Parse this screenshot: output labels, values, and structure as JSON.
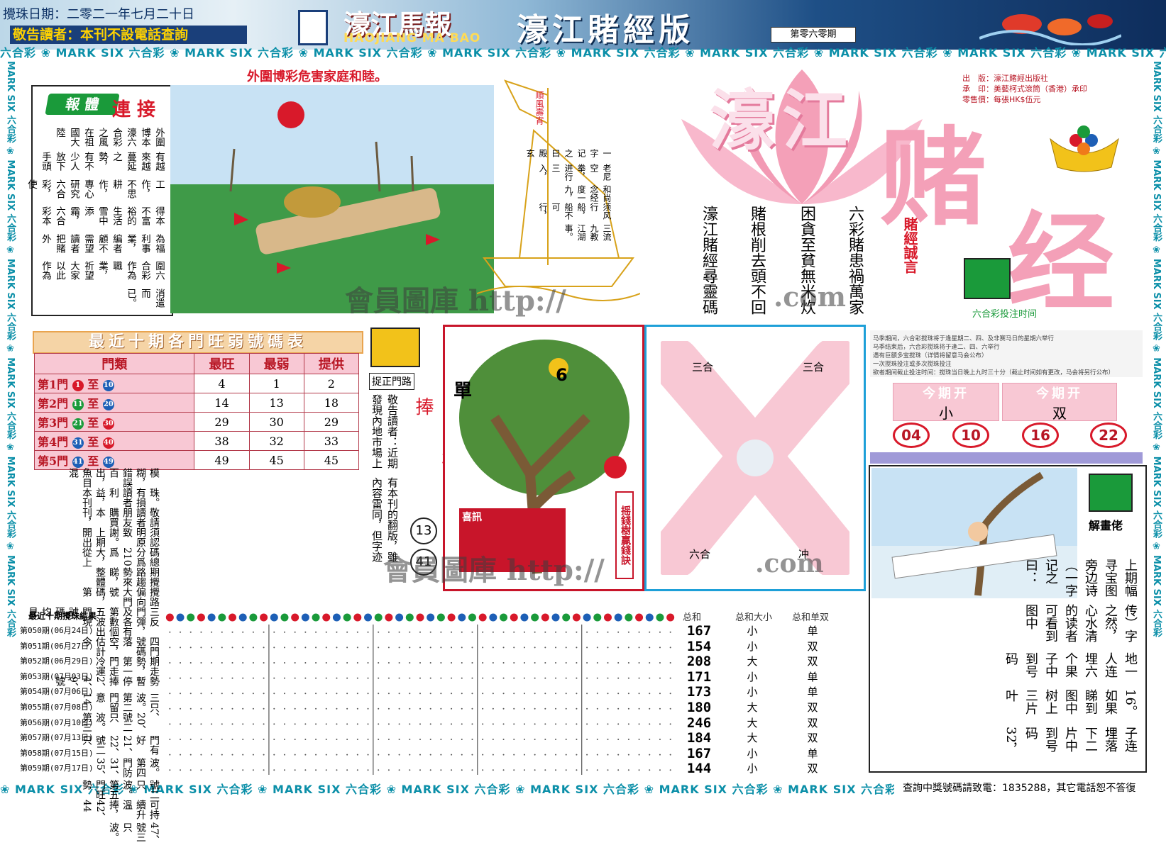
{
  "header": {
    "date_line": "攪珠日期：二零二一年七月二十日",
    "notice": "敬告讀者：本刊不設電話查詢",
    "paper_name": "濠江馬報",
    "paper_en": "HAOJIANG MA BAO",
    "edition": "濠江賭經版",
    "issue": "第零六零期"
  },
  "border": {
    "top": "六合彩 ❀ MARK SIX 六合彩 ❀ MARK SIX 六合彩 ❀ MARK SIX 六合彩 ❀ MARK SIX 六合彩 ❀ MARK SIX 六合彩 ❀ MARK SIX 六合彩 ❀ MARK SIX 六合彩 ❀ MARK SIX 六合彩 ❀ MARK SIX 六合彩 ❀ MARK SIX 六合彩 ❀ MARK SIX",
    "bottom": "❀ MARK SIX 六合彩 ❀ MARK SIX 六合彩 ❀ MARK SIX 六合彩 ❀ MARK SIX 六合彩 ❀ MARK SIX 六合彩 ❀ MARK SIX 六合彩 ❀ MARK SIX 六合彩 ❀ MA",
    "side": "MARK SIX 六合彩 ❀ MARK SIX 六合彩 ❀ MARK SIX 六合彩 ❀ MARK SIX 六合彩 ❀ MARK SIX 六合彩 ❀ MARK SIX 六合彩"
  },
  "article": {
    "headline": "外圍博彩危害家庭和睦。",
    "tag": "報 體",
    "tag2": "連 接",
    "col1": "外圍博本濠六合彩之風在祖國大陸",
    "col2": "有越來越蔓延之勢，有不少人放下手頭",
    "col3": "工作，不思耕作，專心研究六合彩，使",
    "col4": "得本不富裕的生活雪中添霜，六合彩本",
    "col5": "為福利事業，編者顧不需望讀者把賭外",
    "col6": "圍六合彩作為職業，祈望大家以此作為",
    "col7": "消遣而已。"
  },
  "boat": {
    "flag": "順風壽宵",
    "poem_title": "一字记之曰殿玄",
    "poem1": "老尼空拳，进行三入，",
    "poem2": "和尚念经度一九，",
    "poem3": "须风行船，船不可行，",
    "poem4": "三流九教江湖事。"
  },
  "lotus": {
    "title_big": "濠江",
    "title_char1": "赌",
    "title_char2": "经",
    "side_label": "賭經誠言",
    "bettime_label": "六合彩投注时间"
  },
  "motto": {
    "c1": "六彩賭患禍萬家",
    "c2": "困貪至貧無米炊",
    "c3": "賭根削去頭不回",
    "c4": "濠江賭經尋靈碼"
  },
  "publisher": {
    "l1": "出　版：濠江賭經出版社",
    "l2": "承　印：美藝柯式滾筒（香港）承印",
    "l3": "零售價：每張HK$伍元"
  },
  "bet_notes": [
    "马季期间，六合彩搅珠将于逢星期二、四、及非赛马日的星期六举行",
    "马季结束后，六合彩搅珠将于逢二、四、六举行",
    "遇有巨额多宝搅珠（详情将留意马会公布）",
    "一次搅珠投注或多次搅珠投注",
    "欲者期间截止投注时间：搅珠当日晚上九时三十分（截止时间如有更改，马会将另行公布）"
  ],
  "open": {
    "label1": "今期开",
    "label2": "今期开",
    "val1": "小",
    "val2": "双",
    "balls": [
      "04",
      "10",
      "16",
      "22"
    ]
  },
  "table": {
    "title": "最近十期各門旺弱號碼表",
    "headers": [
      "門類",
      "最旺",
      "最弱",
      "提供"
    ],
    "rows": [
      {
        "door": "第1門",
        "from": "1",
        "to": "10",
        "hot": "4",
        "cold": "1",
        "tip": "2"
      },
      {
        "door": "第2門",
        "from": "11",
        "to": "20",
        "hot": "14",
        "cold": "13",
        "tip": "18"
      },
      {
        "door": "第3門",
        "from": "21",
        "to": "30",
        "hot": "29",
        "cold": "30",
        "tip": "29"
      },
      {
        "door": "第4門",
        "from": "31",
        "to": "40",
        "hot": "38",
        "cold": "32",
        "tip": "33"
      },
      {
        "door": "第5門",
        "from": "41",
        "to": "49",
        "hot": "49",
        "cold": "45",
        "tip": "45"
      }
    ]
  },
  "analysis": {
    "c1": "可持續升溫捧，42、44",
    "c2": "號二只波。第五門旺勢",
    "c3": "波。第四門防31、35、",
    "c4": "門有好21、22、號二只",
    "c5": "、20、號二只波。第三",
    "c6": "三只波。第二門留意14",
    "c7": "勢暫停捧2、4、9、號",
    "c8": "期走勢，第一門走冷運",
    "c9": "四門號碼落空，估計今",
    "c10": "反彈，各有數個波出現",
    "c11": "三門及第五門號碼均見",
    "c12": "攪路偏向大門號碼，第",
    "c13": "期攪路趨勢來睇，整體",
    "c14": "碼總分爲210爲大，從上",
    "c15": "須認明原致謝。上期開出",
    "c16": "敬請讀者朋友購買本刊，",
    "c17": "珠。有損讀者利益，本刊",
    "c18": "模糊，錯誤百出，魚目混",
    "tail1": "47、號三只波。",
    "catch_label": "捉正門路",
    "warn1": "敬告讀者：近期發現內地市場上",
    "warn2": "有本刊的翻版，雖內容雷同，但字迹",
    "hot_title": "旺门号码当捧",
    "hot1": "13",
    "hot2": "41"
  },
  "tree": {
    "dan": "單",
    "six": "6",
    "side": "摇錢樹贏錢訣",
    "news": "喜訊"
  },
  "zodiac": {
    "tl": "三合",
    "tr": "三合",
    "bl": "六合",
    "br": "冲"
  },
  "explain": {
    "label": "解畫佬",
    "l1": "上期幅寻宝图旁边诗（一字记之曰：",
    "l2": "传）字之然，心水清的读者可看到图中",
    "l3": "地一人连埋六个果子中到号码",
    "l4": "16。如果睇到图中树上三片叶",
    "l5": "子连埋落下二片中到号码32，"
  },
  "results": {
    "title": "最近十期攪珠結果",
    "col_sum": "总和",
    "col_size": "总和大小",
    "col_oe": "总和单双",
    "rows": [
      {
        "label": "第050期",
        "date": "(06月24日)",
        "sum": "167",
        "size": "小",
        "oe": "单"
      },
      {
        "label": "第051期",
        "date": "(06月27日)",
        "sum": "154",
        "size": "小",
        "oe": "双"
      },
      {
        "label": "第052期",
        "date": "(06月29日)",
        "sum": "208",
        "size": "大",
        "oe": "双"
      },
      {
        "label": "第053期",
        "date": "(07月03日)",
        "sum": "171",
        "size": "小",
        "oe": "单"
      },
      {
        "label": "第054期",
        "date": "(07月06日)",
        "sum": "173",
        "size": "小",
        "oe": "单"
      },
      {
        "label": "第055期",
        "date": "(07月08日)",
        "sum": "180",
        "size": "大",
        "oe": "双"
      },
      {
        "label": "第056期",
        "date": "(07月10日)",
        "sum": "246",
        "size": "大",
        "oe": "双"
      },
      {
        "label": "第057期",
        "date": "(07月13日)",
        "sum": "184",
        "size": "大",
        "oe": "双"
      },
      {
        "label": "第058期",
        "date": "(07月15日)",
        "sum": "167",
        "size": "小",
        "oe": "单"
      },
      {
        "label": "第059期",
        "date": "(07月17日)",
        "sum": "144",
        "size": "小",
        "oe": "双"
      }
    ],
    "ball_colors": {
      "red": "#d8192a",
      "blue": "#1d5fb6",
      "green": "#1a9a3a"
    }
  },
  "watermarks": {
    "w1": "會員圖庫 http://",
    "w2": ".com",
    "w3": "會員圖庫 http://",
    "w4": ".com"
  },
  "footer": "查詢中獎號碼請致電：1835288，其它電話恕不答復"
}
